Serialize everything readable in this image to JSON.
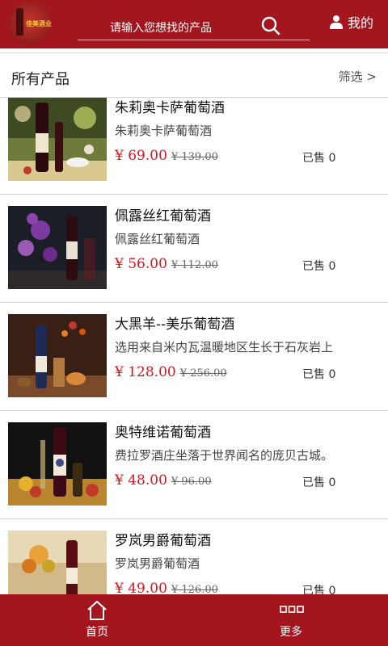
{
  "header": {
    "logo_text": "佳美酒业",
    "search_placeholder": "请输入您想找的产品",
    "user_label": "我的"
  },
  "list": {
    "title": "所有产品",
    "filter_label": "筛选 >"
  },
  "products": [
    {
      "name": "朱莉奥卡萨葡萄酒",
      "desc": "朱莉奥卡萨葡萄酒",
      "price": "¥ 69.00",
      "old_price": "¥ 139.00",
      "sold": "已售 0"
    },
    {
      "name": "佩露丝红葡萄酒",
      "desc": "佩露丝红葡萄酒",
      "price": "¥ 56.00",
      "old_price": "¥ 112.00",
      "sold": "已售 0"
    },
    {
      "name": "大黑羊--美乐葡萄酒",
      "desc": "选用来自米内瓦温暖地区生长于石灰岩上",
      "price": "¥ 128.00",
      "old_price": "¥ 256.00",
      "sold": "已售 0"
    },
    {
      "name": "奥特维诺葡萄酒",
      "desc": "费拉罗酒庄坐落于世界闻名的庞贝古城。",
      "price": "¥ 48.00",
      "old_price": "¥ 96.00",
      "sold": "已售 0"
    },
    {
      "name": "罗岚男爵葡萄酒",
      "desc": "罗岚男爵葡萄酒",
      "price": "¥ 49.00",
      "old_price": "¥ 126.00",
      "sold": "已售 0"
    }
  ],
  "bottom_nav": {
    "home_label": "首页",
    "more_label": "更多"
  },
  "colors": {
    "brand": "#a3161e",
    "price": "#d4161e"
  }
}
